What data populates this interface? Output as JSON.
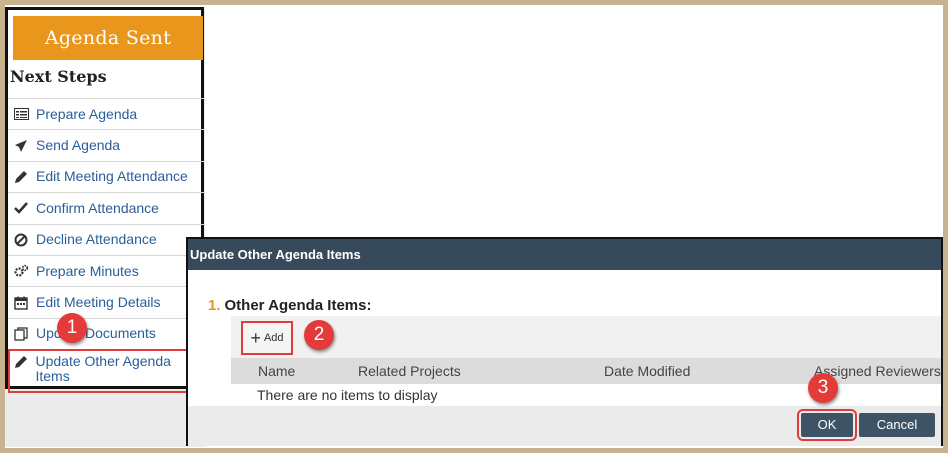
{
  "left_panel": {
    "status": "Agenda Sent",
    "next_steps_title": "Next Steps",
    "steps": [
      {
        "label": "Prepare Agenda",
        "icon": "agenda-list-icon"
      },
      {
        "label": "Send Agenda",
        "icon": "paper-plane-icon"
      },
      {
        "label": "Edit Meeting Attendance",
        "icon": "pencil-icon"
      },
      {
        "label": "Confirm Attendance",
        "icon": "checkmark-icon"
      },
      {
        "label": "Decline Attendance",
        "icon": "no-entry-icon"
      },
      {
        "label": "Prepare Minutes",
        "icon": "gears-icon"
      },
      {
        "label": "Edit Meeting Details",
        "icon": "calendar-icon"
      },
      {
        "label": "Update Documents",
        "icon": "documents-icon"
      },
      {
        "label": "Update Other Agenda Items",
        "icon": "pencil-icon"
      }
    ]
  },
  "dialog": {
    "title": "Update Other Agenda Items",
    "section_number": "1.",
    "section_title": "Other Agenda Items:",
    "add_label": "Add",
    "columns": [
      "Name",
      "Related Projects",
      "Date Modified",
      "Assigned Reviewers"
    ],
    "empty_message": "There are no items to display",
    "ok_label": "OK",
    "cancel_label": "Cancel"
  },
  "callouts": [
    "1",
    "2",
    "3"
  ],
  "colors": {
    "status_banner": "#e8961c",
    "titlebar": "#364a5b",
    "link": "#2a5d9a",
    "callout": "#e33a3a",
    "frame": "#c7b48e"
  }
}
